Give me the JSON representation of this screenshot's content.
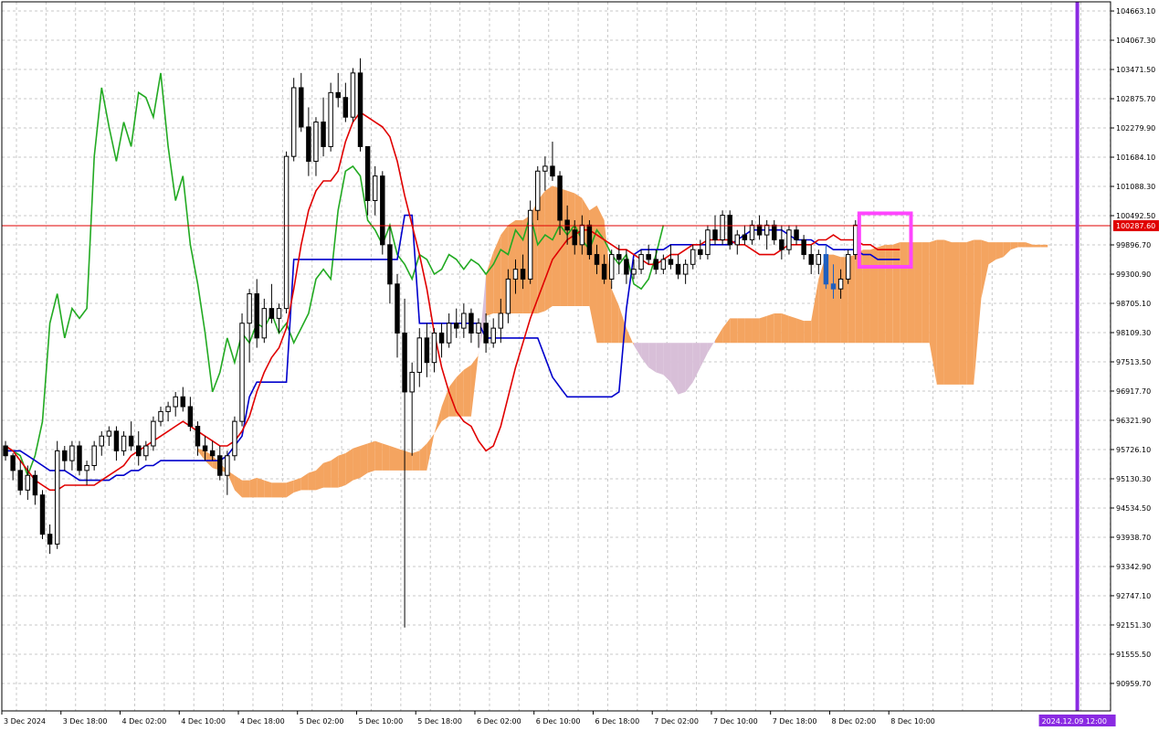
{
  "chart_data": {
    "type": "candlestick",
    "title": "",
    "y_ticks": [
      "104663.10",
      "104067.30",
      "103471.50",
      "102875.70",
      "102279.90",
      "101684.10",
      "101088.30",
      "100492.50",
      "99896.70",
      "99300.90",
      "98705.10",
      "98109.30",
      "97513.50",
      "96917.70",
      "96321.90",
      "95726.10",
      "95130.30",
      "94534.50",
      "93938.70",
      "93342.90",
      "92747.10",
      "92151.30",
      "91555.50",
      "90959.70"
    ],
    "x_ticks": [
      "3 Dec 2024",
      "3 Dec 18:00",
      "4 Dec 02:00",
      "4 Dec 10:00",
      "4 Dec 18:00",
      "5 Dec 02:00",
      "5 Dec 10:00",
      "5 Dec 18:00",
      "6 Dec 02:00",
      "6 Dec 10:00",
      "6 Dec 18:00",
      "7 Dec 02:00",
      "7 Dec 10:00",
      "7 Dec 18:00",
      "8 Dec 02:00",
      "8 Dec 10:00"
    ],
    "ylim": [
      90400,
      104850
    ],
    "grid": true,
    "bar_count": 150,
    "current_price": 100287.6,
    "current_price_label": "100287.60",
    "vertical_marker_label": "2024.12.09 12:00",
    "vertical_marker_bar": 145,
    "highlight_box": {
      "bar_start": 116,
      "bar_end": 122,
      "price_low": 99450,
      "price_high": 100540
    },
    "colors": {
      "bull": "#ffffff",
      "bear": "#000000",
      "tenkan": "#e00000",
      "kijun": "#0000cc",
      "chikou": "#22aa22",
      "cloud_bull": "#f4a460",
      "cloud_bear": "#d8bfd8",
      "price_line": "#e00000",
      "marker": "#8a2be2",
      "highlight": "#ff44ff",
      "grid": "#c8c8c8",
      "last_candle": "#1f5fbf"
    },
    "candles": [
      [
        95800,
        95900,
        95500,
        95600
      ],
      [
        95600,
        95650,
        95100,
        95300
      ],
      [
        95300,
        95500,
        94800,
        94900
      ],
      [
        94900,
        95400,
        94700,
        95200
      ],
      [
        95200,
        95300,
        94600,
        94800
      ],
      [
        94800,
        94900,
        93900,
        94000
      ],
      [
        94000,
        94200,
        93600,
        93800
      ],
      [
        93800,
        95900,
        93700,
        95700
      ],
      [
        95700,
        95800,
        95300,
        95500
      ],
      [
        95500,
        95900,
        95300,
        95800
      ],
      [
        95800,
        95900,
        95200,
        95300
      ],
      [
        95300,
        95500,
        95000,
        95400
      ],
      [
        95400,
        95900,
        95300,
        95800
      ],
      [
        95800,
        96100,
        95600,
        96000
      ],
      [
        96000,
        96200,
        95800,
        96100
      ],
      [
        96100,
        96200,
        95500,
        95700
      ],
      [
        95700,
        96100,
        95600,
        96000
      ],
      [
        96000,
        96300,
        95700,
        95800
      ],
      [
        95800,
        96100,
        95400,
        95600
      ],
      [
        95600,
        95900,
        95500,
        95800
      ],
      [
        95800,
        96400,
        95700,
        96300
      ],
      [
        96300,
        96600,
        96200,
        96500
      ],
      [
        96500,
        96700,
        96300,
        96600
      ],
      [
        96600,
        96900,
        96400,
        96800
      ],
      [
        96800,
        97000,
        96500,
        96600
      ],
      [
        96600,
        96800,
        96100,
        96200
      ],
      [
        96200,
        96300,
        95600,
        95800
      ],
      [
        95800,
        96000,
        95500,
        95700
      ],
      [
        95700,
        95900,
        95500,
        95600
      ],
      [
        95600,
        95800,
        95100,
        95200
      ],
      [
        95200,
        95700,
        94800,
        95600
      ],
      [
        95600,
        96400,
        95500,
        96300
      ],
      [
        96300,
        98500,
        96200,
        98300
      ],
      [
        98300,
        99000,
        97500,
        98900
      ],
      [
        98900,
        99200,
        97800,
        98000
      ],
      [
        98000,
        98800,
        97900,
        98600
      ],
      [
        98600,
        99100,
        98300,
        98400
      ],
      [
        98400,
        98700,
        98100,
        98600
      ],
      [
        98600,
        101800,
        98500,
        101700
      ],
      [
        101700,
        103300,
        101600,
        103100
      ],
      [
        103100,
        103400,
        102200,
        102300
      ],
      [
        102300,
        102700,
        101300,
        101600
      ],
      [
        101600,
        102500,
        101300,
        102400
      ],
      [
        102400,
        102900,
        101700,
        101900
      ],
      [
        101900,
        103200,
        101800,
        103000
      ],
      [
        103000,
        103400,
        102700,
        102900
      ],
      [
        102900,
        103200,
        102400,
        102500
      ],
      [
        102500,
        103500,
        102400,
        103400
      ],
      [
        103400,
        103700,
        101800,
        101900
      ],
      [
        101900,
        101900,
        100500,
        100800
      ],
      [
        100800,
        101500,
        100500,
        101300
      ],
      [
        101300,
        101400,
        99700,
        99900
      ],
      [
        99900,
        100300,
        98700,
        99100
      ],
      [
        99100,
        99300,
        97600,
        98100
      ],
      [
        98100,
        98800,
        92100,
        96900
      ],
      [
        96900,
        97500,
        95600,
        97300
      ],
      [
        97300,
        98200,
        97000,
        98000
      ],
      [
        98000,
        98300,
        97200,
        97500
      ],
      [
        97500,
        98200,
        97300,
        98100
      ],
      [
        98100,
        98300,
        97600,
        97900
      ],
      [
        97900,
        98500,
        97800,
        98300
      ],
      [
        98300,
        98600,
        98000,
        98200
      ],
      [
        98200,
        98700,
        98000,
        98500
      ],
      [
        98500,
        98600,
        97900,
        98100
      ],
      [
        98100,
        98400,
        97800,
        98300
      ],
      [
        98300,
        98500,
        97700,
        97900
      ],
      [
        97900,
        98400,
        97800,
        98200
      ],
      [
        98200,
        98800,
        97900,
        98500
      ],
      [
        98500,
        99400,
        98300,
        99200
      ],
      [
        99200,
        99600,
        98900,
        99400
      ],
      [
        99400,
        99700,
        99000,
        99200
      ],
      [
        99200,
        100800,
        99100,
        100600
      ],
      [
        100600,
        101500,
        100400,
        101400
      ],
      [
        101400,
        101700,
        101000,
        101500
      ],
      [
        101500,
        102000,
        101200,
        101300
      ],
      [
        101300,
        101400,
        100100,
        100400
      ],
      [
        100400,
        100700,
        99900,
        100200
      ],
      [
        100200,
        100400,
        99700,
        99900
      ],
      [
        99900,
        100500,
        99700,
        100300
      ],
      [
        100300,
        100400,
        99600,
        99700
      ],
      [
        99700,
        99900,
        99300,
        99500
      ],
      [
        99500,
        99700,
        99100,
        99200
      ],
      [
        99200,
        99800,
        99000,
        99700
      ],
      [
        99700,
        99900,
        99300,
        99600
      ],
      [
        99600,
        99800,
        99100,
        99300
      ],
      [
        99300,
        99600,
        99200,
        99400
      ],
      [
        99400,
        99800,
        99300,
        99700
      ],
      [
        99700,
        99900,
        99500,
        99600
      ],
      [
        99600,
        99800,
        99300,
        99400
      ],
      [
        99400,
        99700,
        99300,
        99600
      ],
      [
        99600,
        99900,
        99400,
        99500
      ],
      [
        99500,
        99700,
        99200,
        99300
      ],
      [
        99300,
        99600,
        99100,
        99500
      ],
      [
        99500,
        99900,
        99400,
        99800
      ],
      [
        99800,
        100000,
        99600,
        99700
      ],
      [
        99700,
        100300,
        99600,
        100200
      ],
      [
        100200,
        100500,
        99900,
        100000
      ],
      [
        100000,
        100600,
        99900,
        100500
      ],
      [
        100500,
        100600,
        99800,
        99900
      ],
      [
        99900,
        100200,
        99700,
        100100
      ],
      [
        100100,
        100300,
        99900,
        100000
      ],
      [
        100000,
        100400,
        99900,
        100300
      ],
      [
        100300,
        100500,
        100000,
        100100
      ],
      [
        100100,
        100400,
        99800,
        100300
      ],
      [
        100300,
        100400,
        99900,
        100000
      ],
      [
        100000,
        100300,
        99600,
        99800
      ],
      [
        99800,
        100300,
        99700,
        100200
      ],
      [
        100200,
        100300,
        99900,
        100000
      ],
      [
        100000,
        100100,
        99600,
        99700
      ],
      [
        99700,
        99900,
        99300,
        99500
      ],
      [
        99500,
        99800,
        99300,
        99700
      ],
      [
        99700,
        99900,
        99000,
        99100
      ],
      [
        99100,
        99500,
        98800,
        99000
      ],
      [
        99000,
        99400,
        98800,
        99200
      ],
      [
        99200,
        99800,
        99100,
        99700
      ],
      [
        99700,
        100400,
        99600,
        100300
      ]
    ],
    "tenkan": [
      95800,
      95700,
      95500,
      95300,
      95100,
      95000,
      94900,
      94900,
      95000,
      95000,
      95000,
      95000,
      95000,
      95100,
      95200,
      95300,
      95400,
      95600,
      95700,
      95800,
      95900,
      96000,
      96100,
      96200,
      96300,
      96200,
      96100,
      96000,
      95900,
      95800,
      95800,
      95900,
      96100,
      96400,
      96900,
      97300,
      97600,
      97800,
      98200,
      99000,
      99900,
      100600,
      101000,
      101200,
      101200,
      101400,
      102000,
      102400,
      102600,
      102500,
      102400,
      102300,
      102100,
      101600,
      100900,
      100300,
      99700,
      99000,
      98100,
      97400,
      96900,
      96500,
      96300,
      96200,
      95900,
      95700,
      95800,
      96200,
      96800,
      97400,
      97900,
      98400,
      98800,
      99200,
      99600,
      99800,
      100000,
      100100,
      100200,
      100200,
      100100,
      100000,
      99900,
      99800,
      99800,
      99700,
      99600,
      99500,
      99500,
      99600,
      99700,
      99700,
      99800,
      99900,
      99900,
      100000,
      100000,
      100000,
      100000,
      99900,
      99900,
      99800,
      99700,
      99700,
      99700,
      99800,
      99900,
      99900,
      99900,
      99900,
      100000,
      100000,
      100100,
      100000,
      100000,
      100000,
      99900,
      99900,
      99800,
      99800,
      99800,
      99800
    ],
    "kijun": [
      95700,
      95700,
      95700,
      95600,
      95500,
      95400,
      95300,
      95300,
      95300,
      95200,
      95100,
      95100,
      95100,
      95100,
      95100,
      95200,
      95200,
      95300,
      95300,
      95400,
      95400,
      95500,
      95500,
      95500,
      95500,
      95500,
      95500,
      95500,
      95500,
      95500,
      95600,
      95800,
      96000,
      96800,
      97100,
      97100,
      97100,
      97100,
      97100,
      99600,
      99600,
      99600,
      99600,
      99600,
      99600,
      99600,
      99600,
      99600,
      99600,
      99600,
      99600,
      99600,
      99600,
      99600,
      100500,
      100500,
      98300,
      98300,
      98300,
      98300,
      98300,
      98300,
      98300,
      98300,
      98300,
      98000,
      98000,
      98000,
      98000,
      98000,
      98000,
      98000,
      98000,
      97600,
      97200,
      97000,
      96800,
      96800,
      96800,
      96800,
      96800,
      96800,
      96800,
      96900,
      98600,
      99700,
      99800,
      99800,
      99800,
      99800,
      99900,
      99900,
      99900,
      99900,
      99900,
      99900,
      99900,
      99900,
      99900,
      100000,
      100100,
      100200,
      100200,
      100200,
      100200,
      100200,
      100100,
      100000,
      100000,
      100000,
      99900,
      99900,
      99800,
      99800,
      99800,
      99800,
      99700,
      99700,
      99600,
      99600,
      99600,
      99600
    ]
  }
}
